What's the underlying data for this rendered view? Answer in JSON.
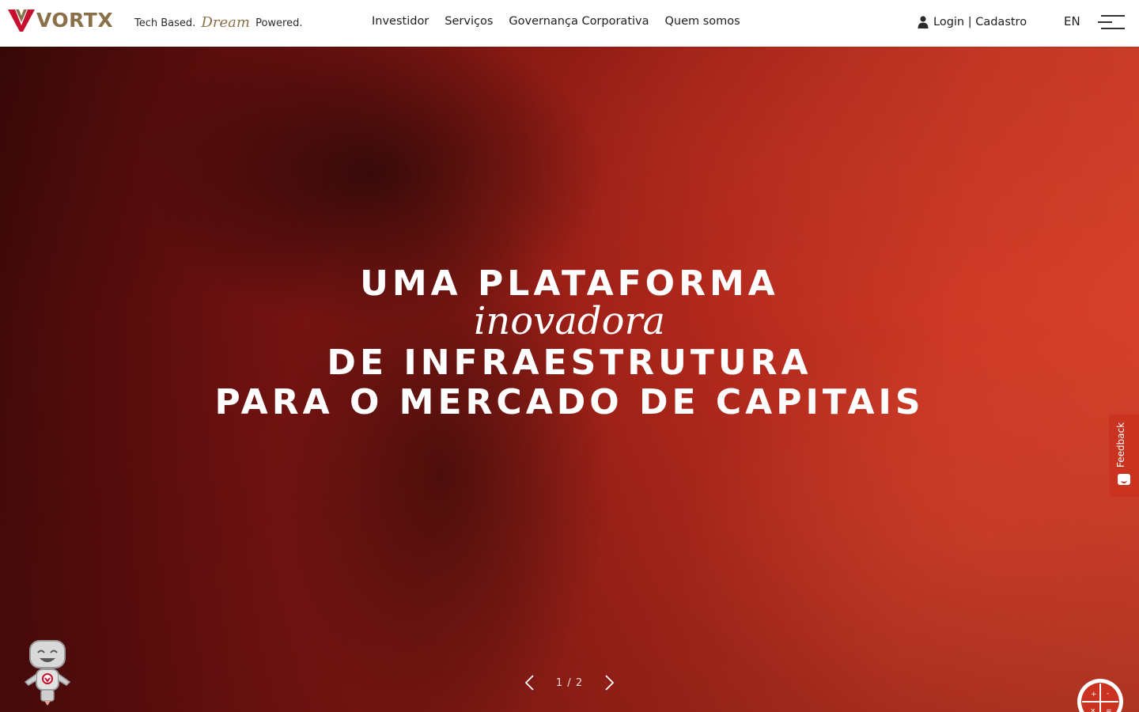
{
  "brand": {
    "name": "VORTX",
    "tagline_before": "Tech Based.",
    "tagline_script": "Dream",
    "tagline_after": "Powered.",
    "color_gold": "#8a7048",
    "color_red": "#c8102e"
  },
  "nav": {
    "items": [
      {
        "label": "Investidor"
      },
      {
        "label": "Serviços"
      },
      {
        "label": "Governança Corporativa"
      },
      {
        "label": "Quem somos"
      }
    ]
  },
  "header": {
    "login_label": "Login | Cadastro",
    "login_icon": "user-icon",
    "language": "EN",
    "menu_icon": "hamburger-menu-icon"
  },
  "hero": {
    "line1": "UMA PLATAFORMA",
    "line2": "inovadora",
    "line3": "DE INFRAESTRUTURA",
    "line4": "PARA O MERCADO DE CAPITAIS",
    "slide_counter": "1 / 2",
    "prev_icon": "chevron-left-icon",
    "next_icon": "chevron-right-icon"
  },
  "widgets": {
    "feedback_label": "Feedback",
    "feedback_icon": "smile-icon",
    "mascot_icon": "robot-mascot-icon",
    "calculator_icon": "calculator-icon",
    "accent_color": "#c9331f"
  }
}
